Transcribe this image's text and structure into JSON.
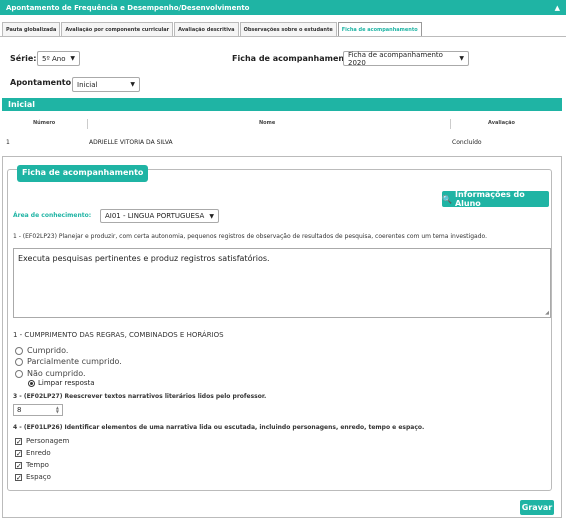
{
  "header": {
    "title": "Apontamento de Frequência e Desempenho/Desenvolvimento",
    "collapse_glyph": "▲"
  },
  "tabs": [
    {
      "label": "Pauta globalizada"
    },
    {
      "label": "Avaliação por componente curricular"
    },
    {
      "label": "Avaliação descritiva"
    },
    {
      "label": "Observações sobre o estudante"
    },
    {
      "label": "Ficha de acompanhamento"
    }
  ],
  "filters": {
    "serie_label": "Série:",
    "serie_value": "5º Ano",
    "ficha_label": "Ficha de acompanhamento:",
    "ficha_value": "Ficha de acompanhamento 2020",
    "apontamento_label": "Apontamento:",
    "apontamento_value": "Inicial"
  },
  "section": {
    "title": "Inicial"
  },
  "table": {
    "headers": [
      "Número",
      "Nome",
      "Avaliação"
    ],
    "rows": [
      {
        "numero": "1",
        "nome": "ADRIELLE VITORIA DA SILVA",
        "avaliacao": "Concluído"
      }
    ]
  },
  "ficha": {
    "legend": "Ficha de acompanhamento",
    "info_button": "Informações do Aluno",
    "area_label": "Área de conhecimento:",
    "area_value": "AI01 - LINGUA PORTUGUESA",
    "q1_text": "1 - (EF02LP23) Planejar e produzir, com certa autonomia, pequenos registros de observação de resultados de pesquisa, coerentes com um tema investigado.",
    "q1_answer": "Executa pesquisas pertinentes e produz registros satisfatórios.",
    "q2_title": "1 - CUMPRIMENTO DAS REGRAS, COMBINADOS E HORÁRIOS",
    "q2_options": [
      "Cumprido.",
      "Parcialmente cumprido.",
      "Não cumprido."
    ],
    "q2_clear": "Limpar resposta",
    "q3_text": "3 - (EF02LP27) Reescrever textos narrativos literários lidos pelo professor.",
    "q3_value": "8",
    "q4_text": "4 - (EF01LP26) Identificar elementos de uma narrativa lida ou escutada, incluindo personagens, enredo, tempo e espaço.",
    "q4_options": [
      "Personagem",
      "Enredo",
      "Tempo",
      "Espaço"
    ],
    "save_button": "Gravar"
  },
  "colors": {
    "accent": "#1fb4a4"
  }
}
